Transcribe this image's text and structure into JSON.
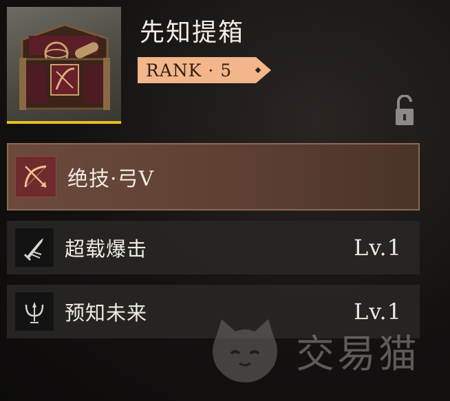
{
  "item": {
    "title": "先知提箱",
    "rank_label": "RANK · 5",
    "thumbnail_icon": "treasure-chest-icon",
    "rarity_color": "#e8c21a",
    "lock_icon": "unlocked-padlock-icon"
  },
  "skills": [
    {
      "name": "绝技·弓V",
      "level": "",
      "icon": "bow-arrow-icon",
      "type": "ultimate"
    },
    {
      "name": "超载爆击",
      "level": "Lv.1",
      "icon": "sword-strike-icon",
      "type": "normal"
    },
    {
      "name": "预知未来",
      "level": "Lv.1",
      "icon": "trident-icon",
      "type": "normal"
    }
  ],
  "watermark": {
    "text": "交易猫",
    "icon": "cat-face-logo-icon"
  },
  "colors": {
    "rank_badge": "#f3b58a",
    "ultimate_row": "#6b4a3c",
    "normal_row": "#282625"
  }
}
